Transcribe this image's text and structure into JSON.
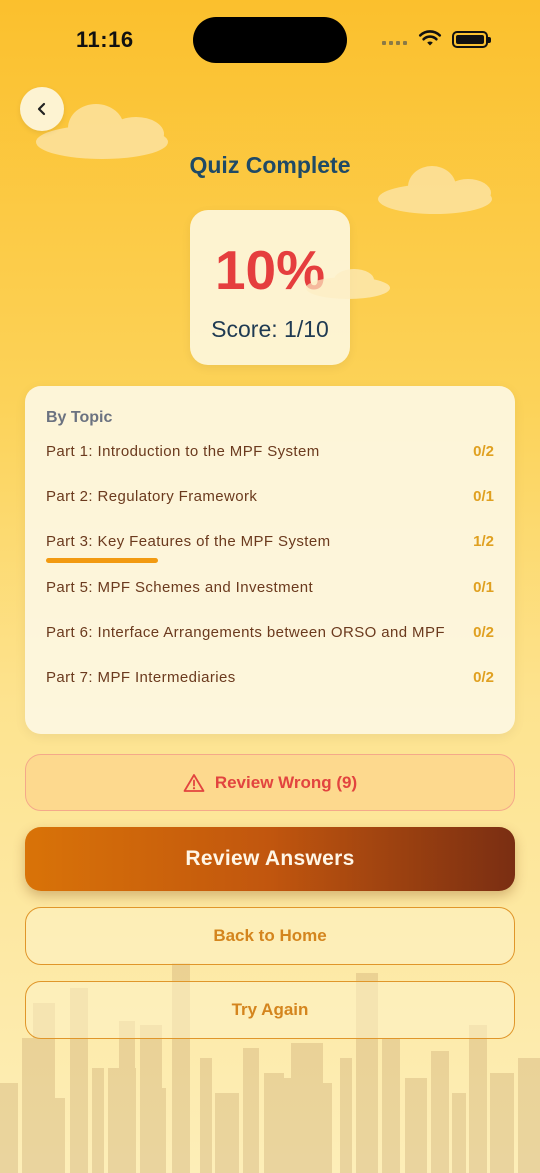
{
  "status_bar": {
    "time": "11:16"
  },
  "header": {
    "title": "Quiz Complete"
  },
  "score": {
    "percent": "10%",
    "fraction": "Score: 1/10"
  },
  "topics": {
    "heading": "By Topic",
    "items": [
      {
        "name": "Part 1: Introduction to the MPF System",
        "score": "0/2",
        "progress": 0
      },
      {
        "name": "Part 2: Regulatory Framework",
        "score": "0/1",
        "progress": 0
      },
      {
        "name": "Part 3: Key Features of the MPF System",
        "score": "1/2",
        "progress": 0.5
      },
      {
        "name": "Part 5: MPF Schemes and Investment",
        "score": "0/1",
        "progress": 0
      },
      {
        "name": "Part 6: Interface Arrangements between ORSO and MPF",
        "score": "0/2",
        "progress": 0
      },
      {
        "name": "Part 7: MPF Intermediaries",
        "score": "0/2",
        "progress": 0
      }
    ]
  },
  "actions": {
    "review_wrong_label": "Review Wrong (9)",
    "review_answers_label": "Review Answers",
    "back_home_label": "Back to Home",
    "try_again_label": "Try Again"
  },
  "icons": {
    "back": "chevron-left-icon",
    "warning": "warning-triangle-icon",
    "wifi": "wifi-icon",
    "battery": "battery-icon"
  },
  "colors": {
    "background_top": "#fbc02d",
    "background_bottom": "#fdeeb8",
    "title": "#1f4a66",
    "score_percent": "#e53e3e",
    "topic_score": "#e0a020",
    "progress_fill": "#f29a11",
    "warning_text": "#e2443f",
    "primary_button_start": "#d97308",
    "primary_button_end": "#7a2e12",
    "outline_button": "#e0962a"
  }
}
